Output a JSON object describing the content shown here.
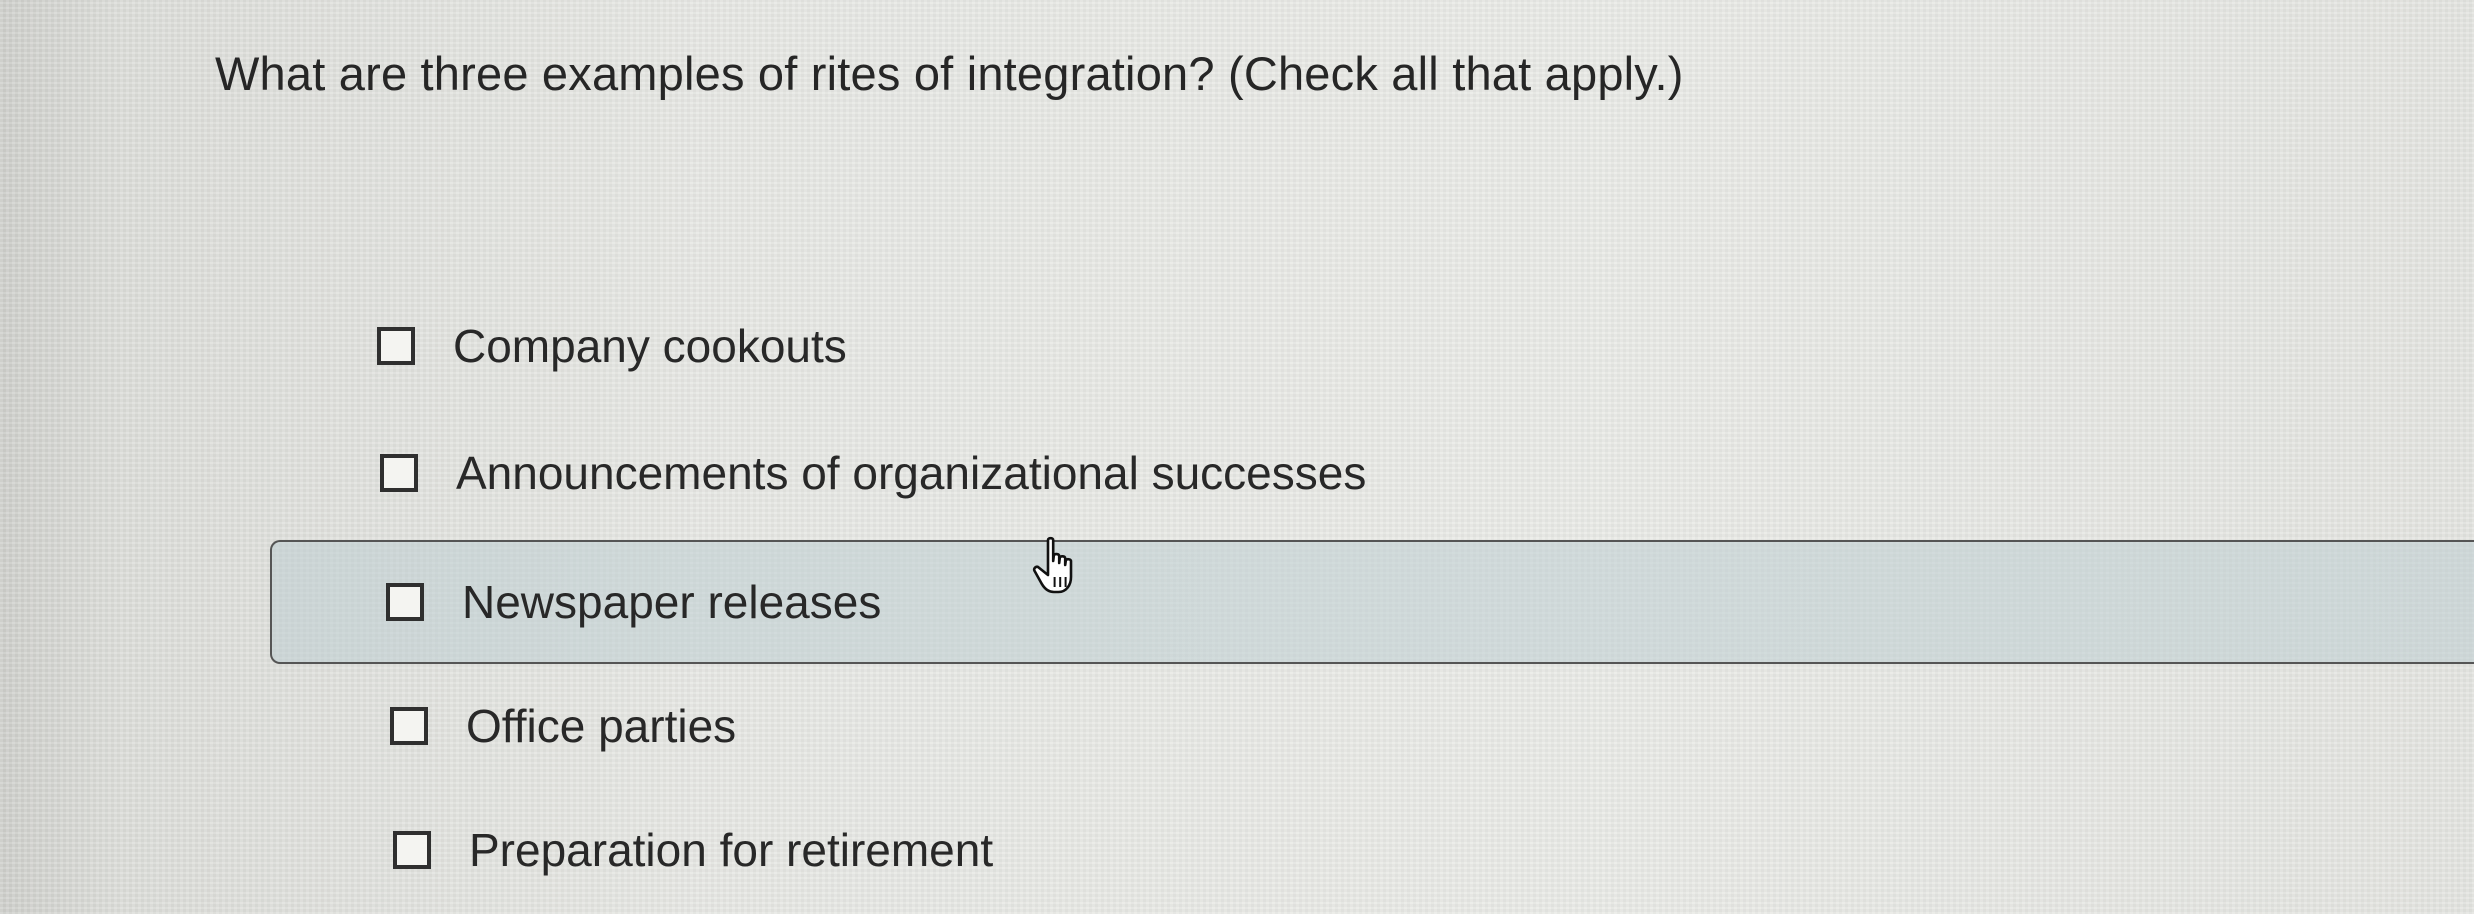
{
  "question": {
    "text": "What are three examples of rites of integration? (Check all that apply.)"
  },
  "options": [
    {
      "label": "Company cookouts",
      "checked": false,
      "highlighted": false
    },
    {
      "label": "Announcements of organizational successes",
      "checked": false,
      "highlighted": false
    },
    {
      "label": "Newspaper releases",
      "checked": false,
      "highlighted": true
    },
    {
      "label": "Office parties",
      "checked": false,
      "highlighted": false
    },
    {
      "label": "Preparation for retirement",
      "checked": false,
      "highlighted": false
    }
  ],
  "cursor": {
    "icon": "hand-pointer-icon"
  },
  "colors": {
    "highlight_background": "#c6d2d4",
    "text": "#282828",
    "checkbox_border": "#2f2f2f"
  }
}
